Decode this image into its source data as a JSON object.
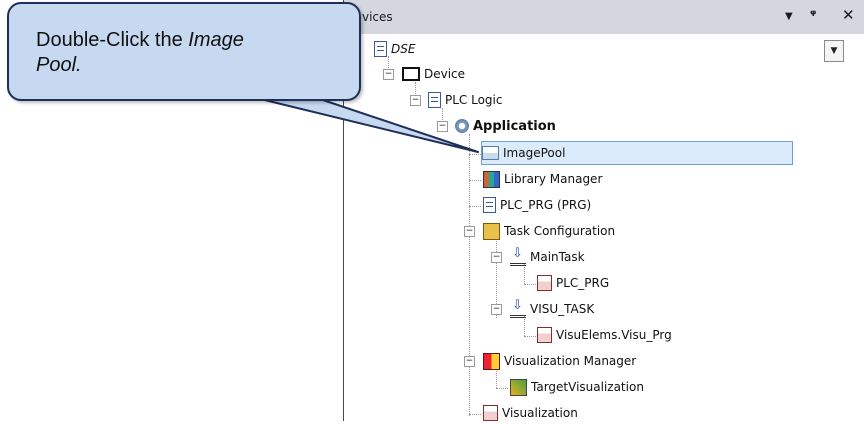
{
  "panel": {
    "title": "Devices",
    "title_visible": "vices"
  },
  "callout": {
    "text_prefix": "Double-Click the ",
    "text_emphasis": "Image",
    "text_emphasis2": "Pool."
  },
  "tree": {
    "dse": "DSE",
    "device": "Device",
    "plc_logic": "PLC Logic",
    "application": "Application",
    "imagepool": "ImagePool",
    "library_manager": "Library Manager",
    "plc_prg": "PLC_PRG (PRG)",
    "task_configuration": "Task Configuration",
    "maintask": "MainTask",
    "maintask_plc_prg": "PLC_PRG",
    "visu_task": "VISU_TASK",
    "visuelems": "VisuElems.Visu_Prg",
    "visualization_manager": "Visualization Manager",
    "target_visualization": "TargetVisualization",
    "visualization": "Visualization"
  },
  "icons": {
    "menu": "dropdown-arrow-icon",
    "pin": "pin-icon",
    "close": "close-icon"
  }
}
